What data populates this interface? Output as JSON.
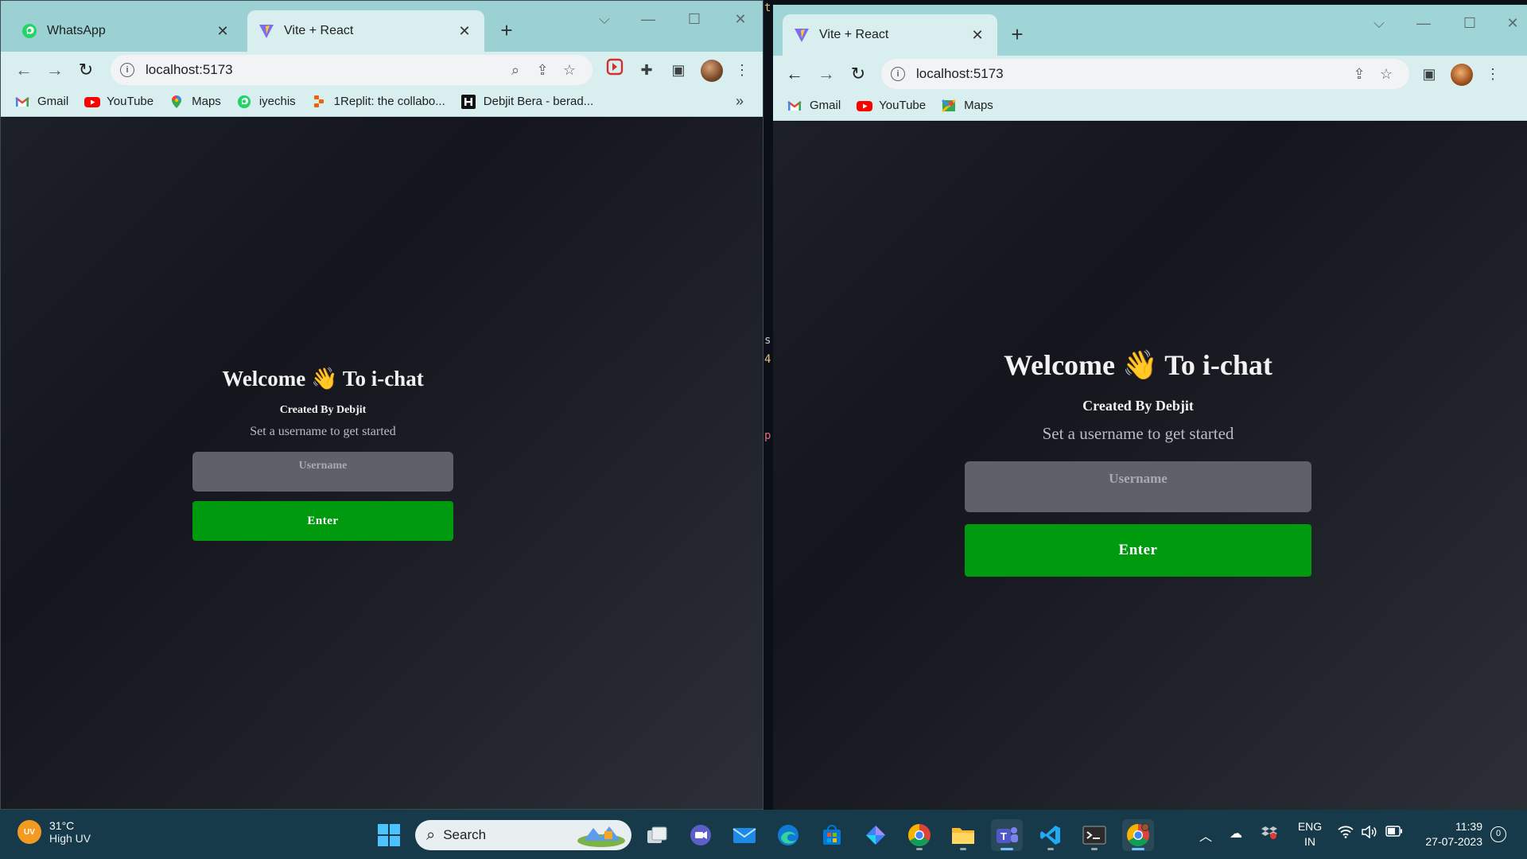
{
  "left_window": {
    "tabs": [
      {
        "label": "WhatsApp",
        "icon": "whatsapp-icon"
      },
      {
        "label": "Vite + React",
        "icon": "vite-icon"
      }
    ],
    "url": "localhost:5173",
    "bookmarks": [
      {
        "label": "Gmail",
        "icon": "gmail-icon"
      },
      {
        "label": "YouTube",
        "icon": "youtube-icon"
      },
      {
        "label": "Maps",
        "icon": "maps-icon"
      },
      {
        "label": "iyechis",
        "icon": "whatsapp-icon"
      },
      {
        "label": "1Replit: the collabo...",
        "icon": "replit-icon"
      },
      {
        "label": "Debjit Bera - berad...",
        "icon": "hashnode-icon"
      }
    ],
    "bookmarks_more": "»"
  },
  "right_window": {
    "tabs": [
      {
        "label": "Vite + React",
        "icon": "vite-icon"
      }
    ],
    "url": "localhost:5173",
    "bookmarks": [
      {
        "label": "Gmail",
        "icon": "gmail-icon"
      },
      {
        "label": "YouTube",
        "icon": "youtube-icon"
      },
      {
        "label": "Maps",
        "icon": "maps-icon"
      }
    ]
  },
  "app": {
    "title_prefix": "Welcome",
    "wave": "👋",
    "title_suffix": "To i-chat",
    "byline": "Created By Debjit",
    "subtitle": "Set a username to get started",
    "username_placeholder": "Username",
    "enter_label": "Enter",
    "accent_color": "#009a0f"
  },
  "taskbar": {
    "weather_temp": "31°C",
    "weather_desc": "High UV",
    "uv_badge": "UV",
    "search_label": "Search",
    "lang_line1": "ENG",
    "lang_line2": "IN",
    "time": "11:39",
    "date": "27-07-2023",
    "notification_count": "0"
  }
}
